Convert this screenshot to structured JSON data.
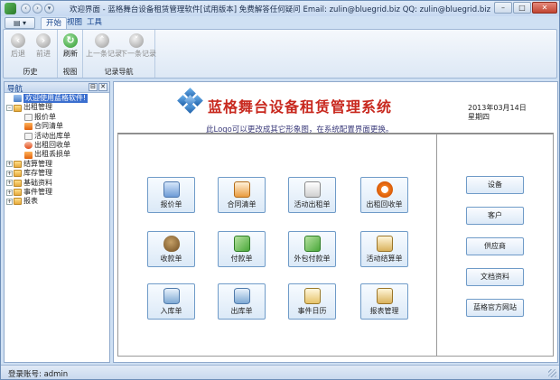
{
  "window": {
    "title": "欢迎界面 - 蓝格舞台设备租赁管理软件[试用版本] 免费解答任何疑问 Email: zulin@bluegrid.biz QQ: zulin@bluegrid.biz",
    "controls": {
      "minimize": "–",
      "maximize": "□",
      "close": "✕"
    }
  },
  "ribbon": {
    "menu_button": "▤ ▾",
    "tabs": [
      {
        "label": "开始",
        "active": true
      },
      {
        "label": "视图"
      },
      {
        "label": "工具"
      }
    ],
    "groups": {
      "history": {
        "label": "历史",
        "back": "后退",
        "forward": "前进"
      },
      "view": {
        "label": "视图",
        "refresh": "刷新"
      },
      "record_nav": {
        "label": "记录导航",
        "prev": "上一条记录",
        "next": "下一条记录"
      }
    }
  },
  "nav": {
    "title": "导航",
    "pin": "⊟",
    "close": "✕",
    "tree": [
      {
        "label": "欢迎使用蓝格软件!",
        "level": 0,
        "icon": "home-icon",
        "selected": true
      },
      {
        "label": "出租管理",
        "level": 0,
        "icon": "folder-icon",
        "expander": "–"
      },
      {
        "label": "报价单",
        "level": 1,
        "icon": "document-icon"
      },
      {
        "label": "合同清单",
        "level": 1,
        "icon": "contract-icon"
      },
      {
        "label": "活动出库单",
        "level": 1,
        "icon": "document-icon"
      },
      {
        "label": "出租回收单",
        "level": 1,
        "icon": "recycle-icon"
      },
      {
        "label": "出租丢损单",
        "level": 1,
        "icon": "damage-icon"
      },
      {
        "label": "结算管理",
        "level": 0,
        "icon": "folder-icon",
        "expander": "+"
      },
      {
        "label": "库存管理",
        "level": 0,
        "icon": "folder-icon",
        "expander": "+"
      },
      {
        "label": "基础资料",
        "level": 0,
        "icon": "folder-icon",
        "expander": "+"
      },
      {
        "label": "事件管理",
        "level": 0,
        "icon": "folder-icon",
        "expander": "+"
      },
      {
        "label": "报表",
        "level": 0,
        "icon": "folder-icon",
        "expander": "+"
      }
    ]
  },
  "main": {
    "system_title": "蓝格舞台设备租赁管理系统",
    "date": "2013年03月14日",
    "weekday": "星期四",
    "logo_note": "此Logo可以更改成其它形象图，在系统配置界面更换。",
    "grid_buttons": [
      {
        "label": "报价单",
        "icon": "quote-icon"
      },
      {
        "label": "合同清单",
        "icon": "contract-icon"
      },
      {
        "label": "活动出租单",
        "icon": "checklist-icon"
      },
      {
        "label": "出租回收单",
        "icon": "recycle-icon"
      },
      {
        "label": "收款单",
        "icon": "money-bag-icon"
      },
      {
        "label": "付款单",
        "icon": "banknote-icon"
      },
      {
        "label": "外包付款单",
        "icon": "banknote-icon"
      },
      {
        "label": "活动结算单",
        "icon": "clipboard-icon"
      },
      {
        "label": "入库单",
        "icon": "database-icon"
      },
      {
        "label": "出库单",
        "icon": "database-icon"
      },
      {
        "label": "事件日历",
        "icon": "calendar-icon"
      },
      {
        "label": "报表管理",
        "icon": "report-icon"
      }
    ],
    "side_buttons": [
      "设备",
      "客户",
      "供应商",
      "文档资料",
      "蓝格官方网站"
    ]
  },
  "status": {
    "text": "登录账号: admin"
  }
}
